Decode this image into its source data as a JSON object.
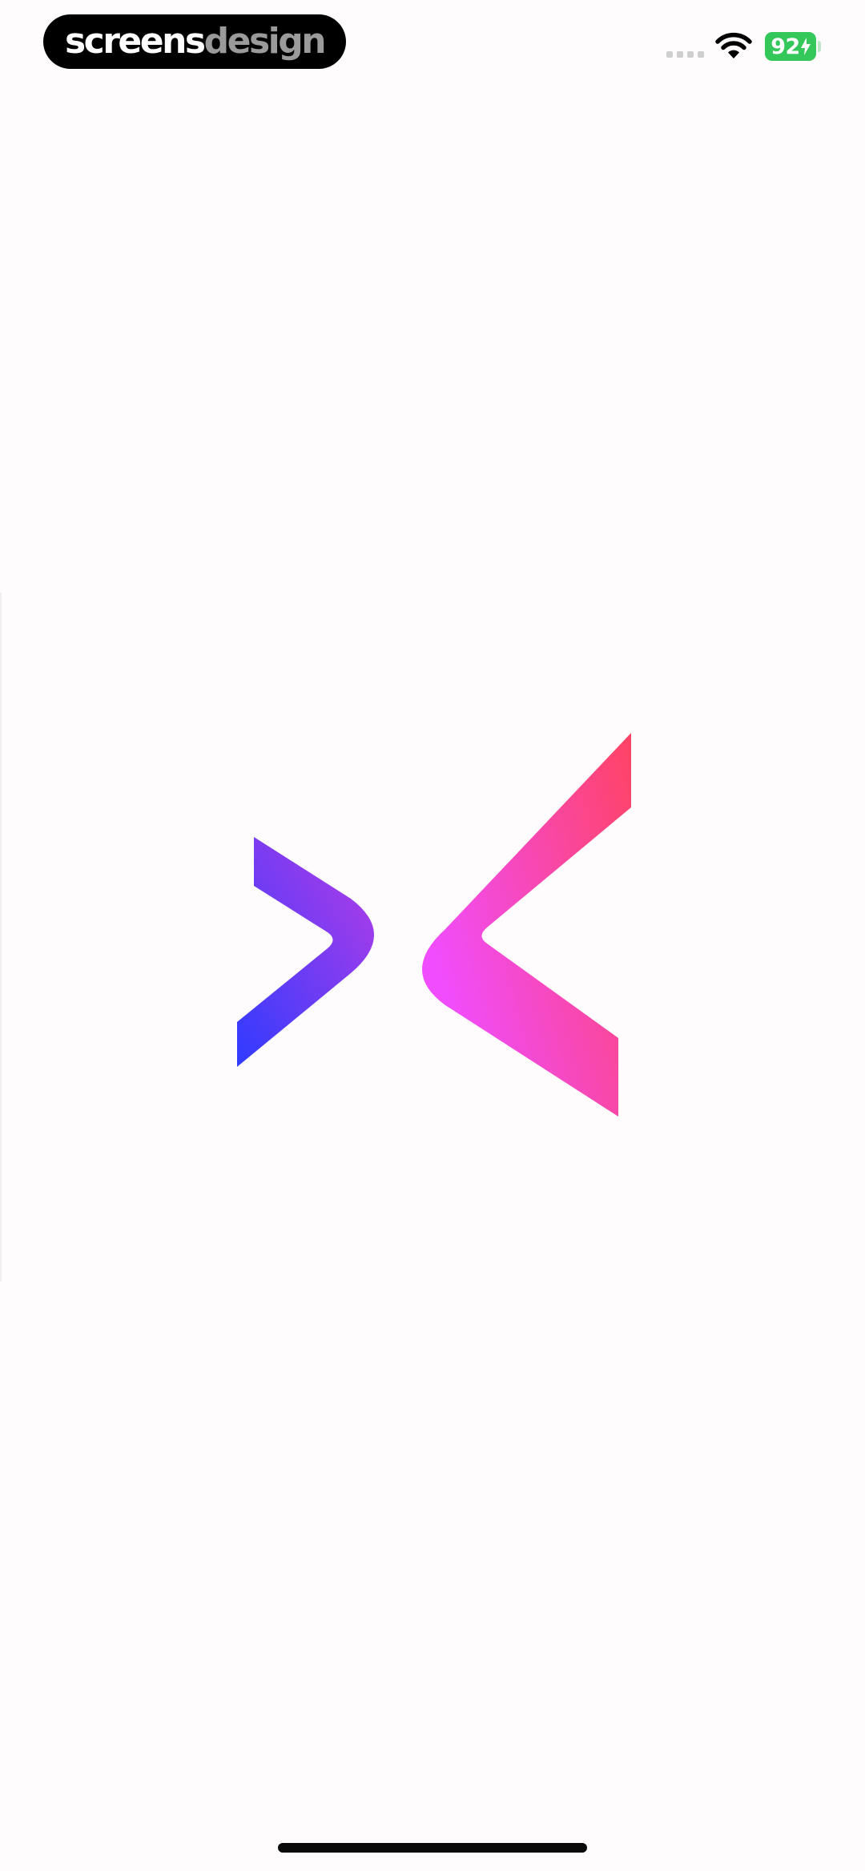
{
  "status_bar": {
    "brand": {
      "part1": "screens",
      "part2": "design"
    },
    "cell_signal_icon": "cellular-signal-icon",
    "wifi_icon": "wifi-icon",
    "battery": {
      "level": "92",
      "charging": true,
      "color": "#34c759",
      "icon": "battery-charging-icon"
    }
  },
  "splash": {
    "logo_icon": "app-logo-icon",
    "colors": {
      "left_chevron": [
        "#2f3bff",
        "#b83de6"
      ],
      "right_chevron": [
        "#f04dff",
        "#ff4363"
      ],
      "background": "#fffcfd"
    }
  },
  "home_indicator": {
    "icon": "home-indicator-bar"
  }
}
